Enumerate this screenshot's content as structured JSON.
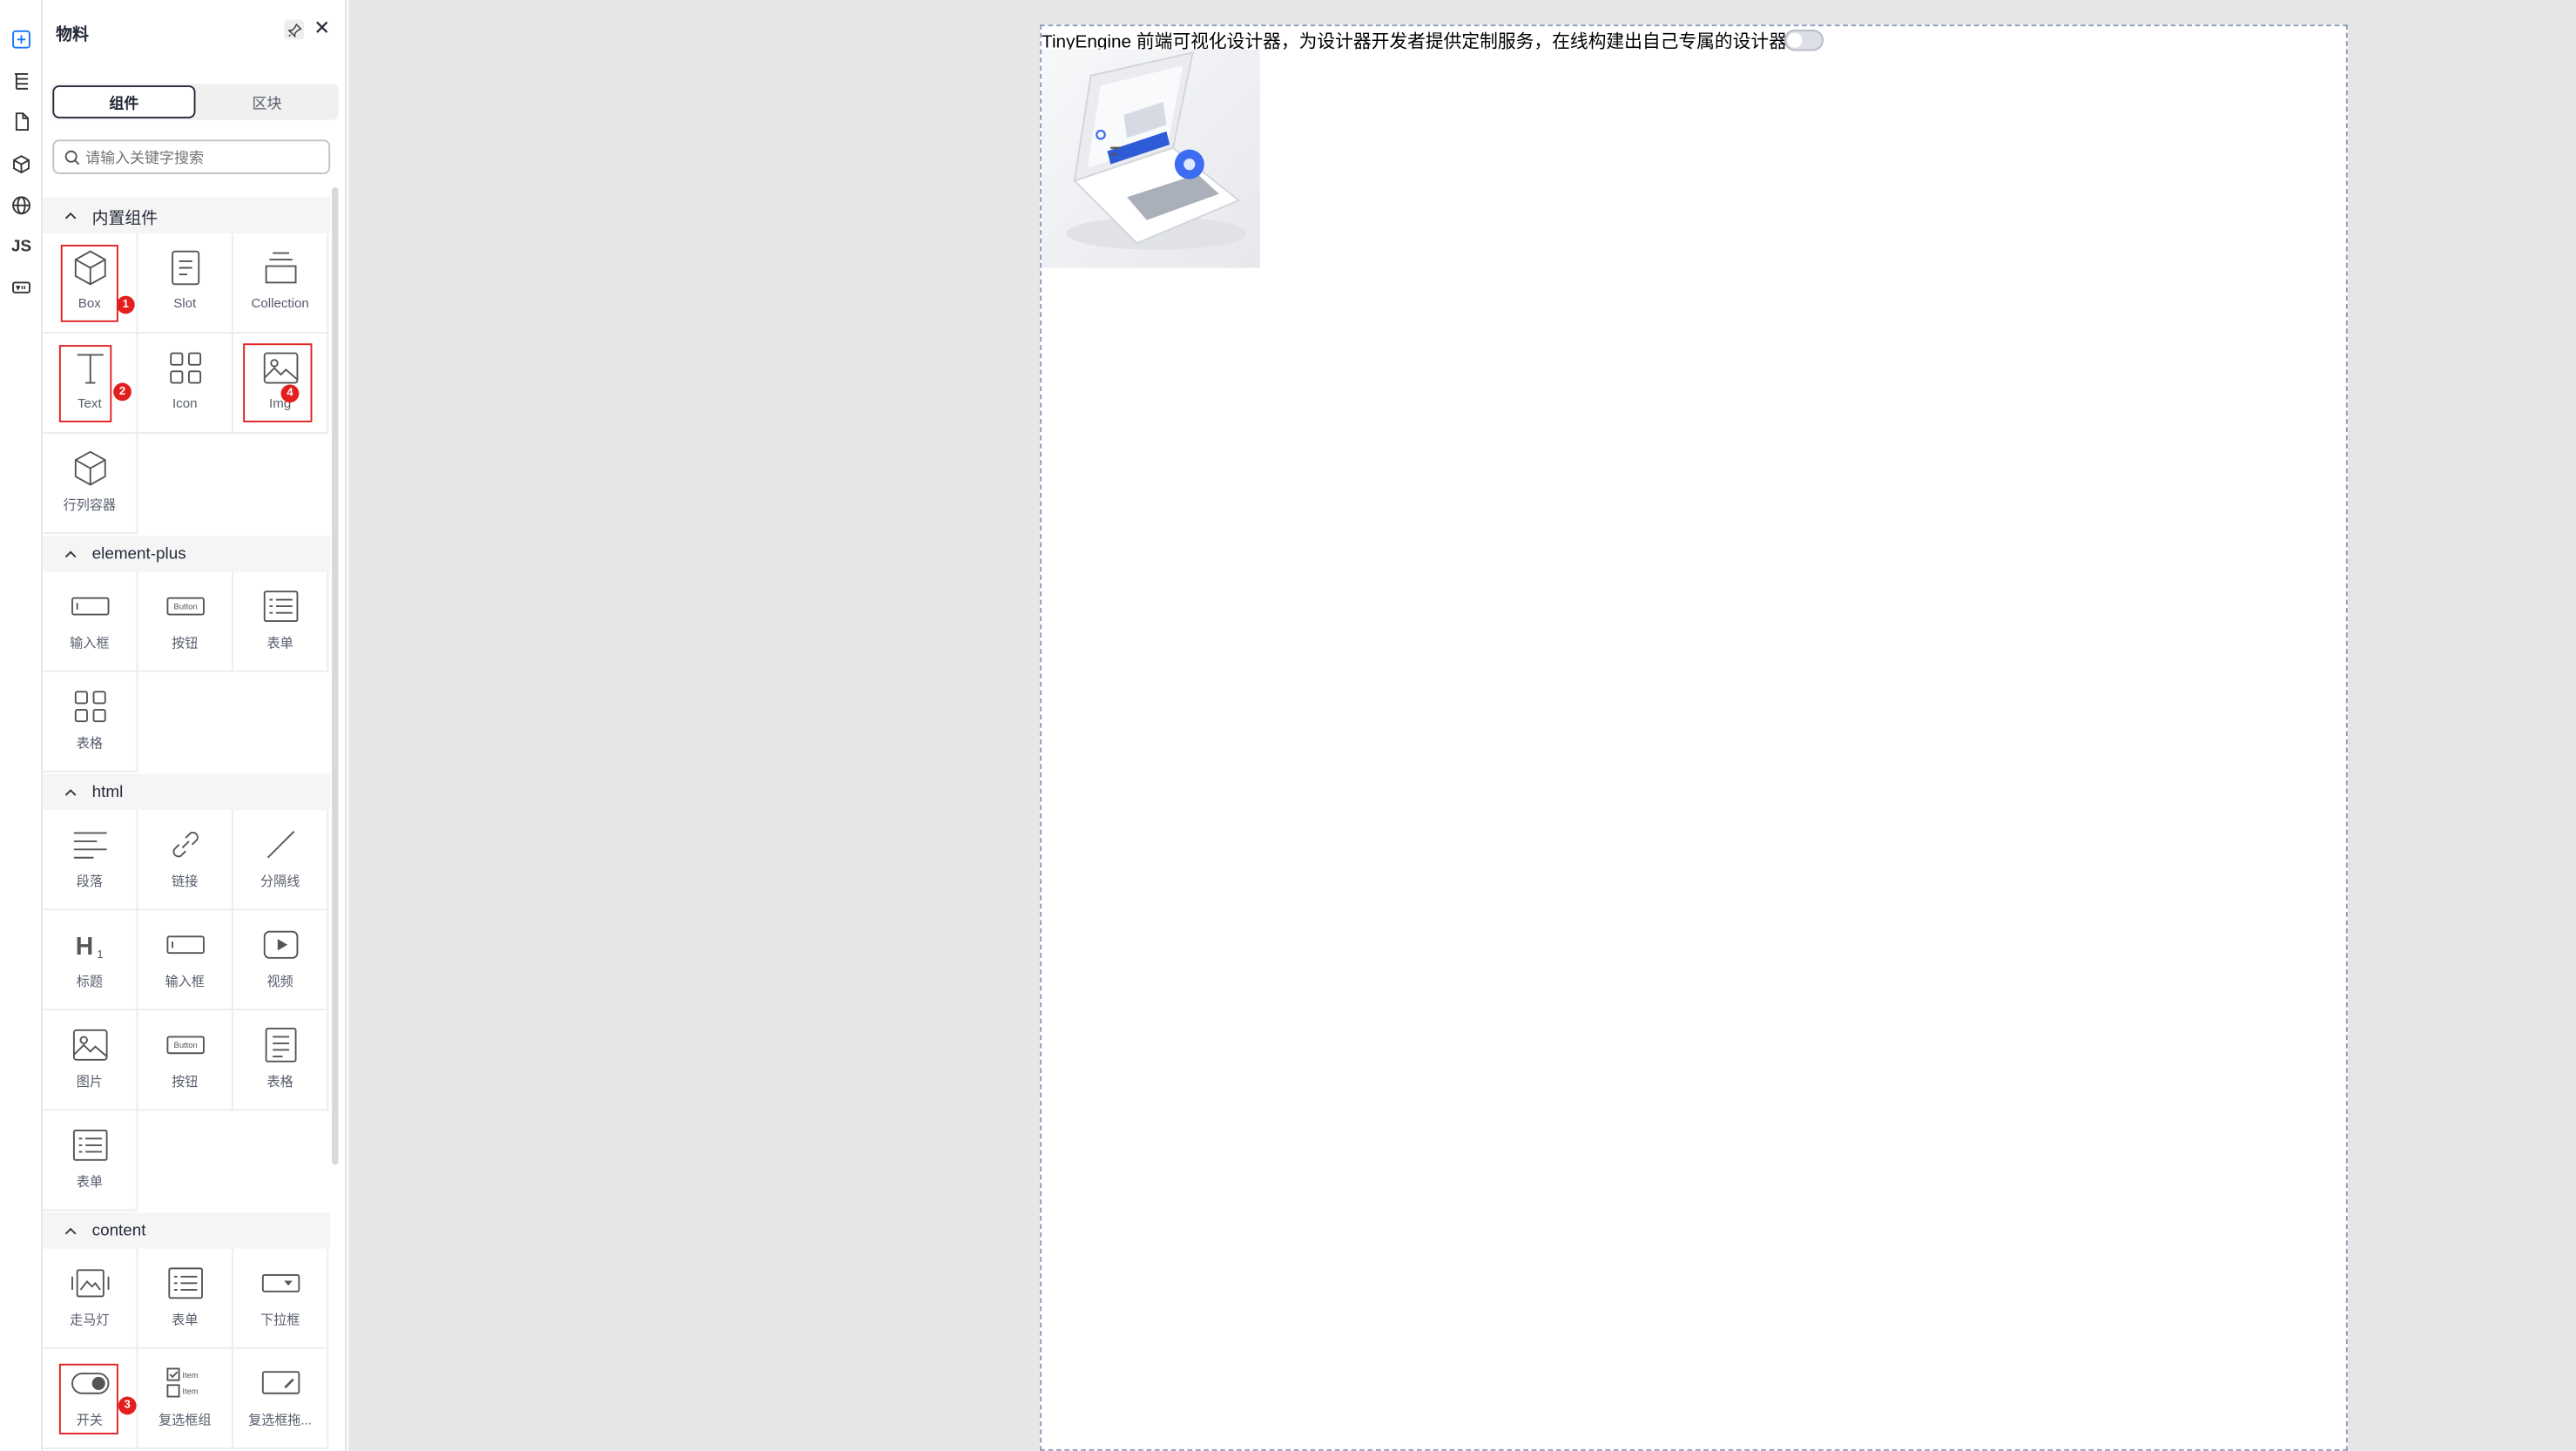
{
  "rail": {
    "items": [
      "add-component-icon",
      "layer-tree-icon",
      "page-icon",
      "block-cube-icon",
      "globe-icon",
      "JS",
      "variable-icon"
    ]
  },
  "panel": {
    "title": "物料",
    "tabs": [
      "组件",
      "区块"
    ],
    "search_placeholder": "请输入关键字搜索",
    "categories": [
      {
        "name": "内置组件",
        "items": [
          "Box",
          "Slot",
          "Collection",
          "Text",
          "Icon",
          "Img",
          "行列容器"
        ]
      },
      {
        "name": "element-plus",
        "items": [
          "输入框",
          "按钮",
          "表单",
          "表格"
        ]
      },
      {
        "name": "html",
        "items": [
          "段落",
          "链接",
          "分隔线",
          "标题",
          "输入框",
          "视频",
          "图片",
          "按钮",
          "表格",
          "表单"
        ]
      },
      {
        "name": "content",
        "items": [
          "走马灯",
          "表单",
          "下拉框",
          "开关",
          "复选框组",
          "复选框拖..."
        ]
      }
    ],
    "badges": [
      "1",
      "2",
      "3",
      "4"
    ]
  },
  "canvas": {
    "text": "TinyEngine 前端可视化设计器，为设计器开发者提供定制服务，在线构建出自己专属的设计器。",
    "switch_on": false
  },
  "colors": {
    "accent": "#1476ff",
    "highlight": "#e21e1e",
    "canvas_bg": "#e6e6e6"
  }
}
